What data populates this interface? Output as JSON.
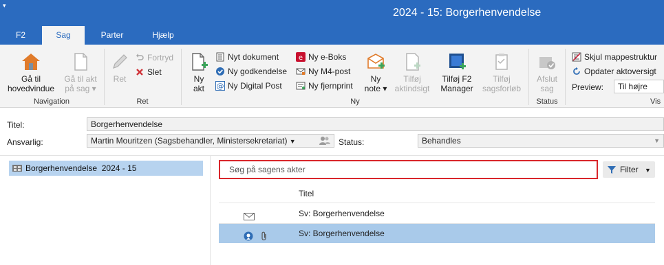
{
  "window": {
    "title": "2024 - 15: Borgerhenvendelse",
    "quick_access": "▾"
  },
  "tabs": [
    {
      "label": "F2"
    },
    {
      "label": "Sag"
    },
    {
      "label": "Parter"
    },
    {
      "label": "Hjælp"
    }
  ],
  "ribbon": {
    "groups": {
      "navigation": "Navigation",
      "ret": "Ret",
      "ny": "Ny",
      "status": "Status",
      "vis": "Vis"
    },
    "navigation": {
      "go_main_1": "Gå til",
      "go_main_2": "hovedvindue",
      "go_act_1": "Gå til akt",
      "go_act_2": "på sag"
    },
    "ret": {
      "ret": "Ret",
      "fortryd": "Fortryd",
      "slet": "Slet"
    },
    "ny": {
      "ny_akt_1": "Ny",
      "ny_akt_2": "akt",
      "nyt_dokument": "Nyt dokument",
      "ny_godkendelse": "Ny godkendelse",
      "ny_digital_post": "Ny Digital Post",
      "ny_eboks": "Ny e-Boks",
      "ny_m4post": "Ny M4-post",
      "ny_fjernprint": "Ny fjernprint",
      "ny_note_1": "Ny",
      "ny_note_2": "note",
      "tilfoej_akt_1": "Tilføj",
      "tilfoej_akt_2": "aktindsigt",
      "tilfoej_f2_1": "Tilføj F2",
      "tilfoej_f2_2": "Manager",
      "tilfoej_forloeb_1": "Tilføj",
      "tilfoej_forloeb_2": "sagsforløb"
    },
    "status": {
      "afslut_1": "Afslut",
      "afslut_2": "sag"
    },
    "vis": {
      "skjul": "Skjul mappestruktur",
      "opdater": "Opdater aktoversigt",
      "preview_label": "Preview:",
      "preview_value": "Til højre"
    }
  },
  "form": {
    "titel_label": "Titel:",
    "titel_value": "Borgerhenvendelse",
    "ansvarlig_label": "Ansvarlig:",
    "ansvarlig_value": "Martin Mouritzen (Sagsbehandler, Ministersekretariat)",
    "status_label": "Status:",
    "status_value": "Behandles"
  },
  "tree": {
    "item": "Borgerhenvendelse  2024 - 15"
  },
  "search": {
    "placeholder": "Søg på sagens akter"
  },
  "filter": {
    "label": "Filter"
  },
  "table": {
    "column": "Titel",
    "rows": [
      {
        "title": "Sv: Borgerhenvendelse"
      },
      {
        "title": "Sv: Borgerhenvendelse"
      }
    ]
  }
}
